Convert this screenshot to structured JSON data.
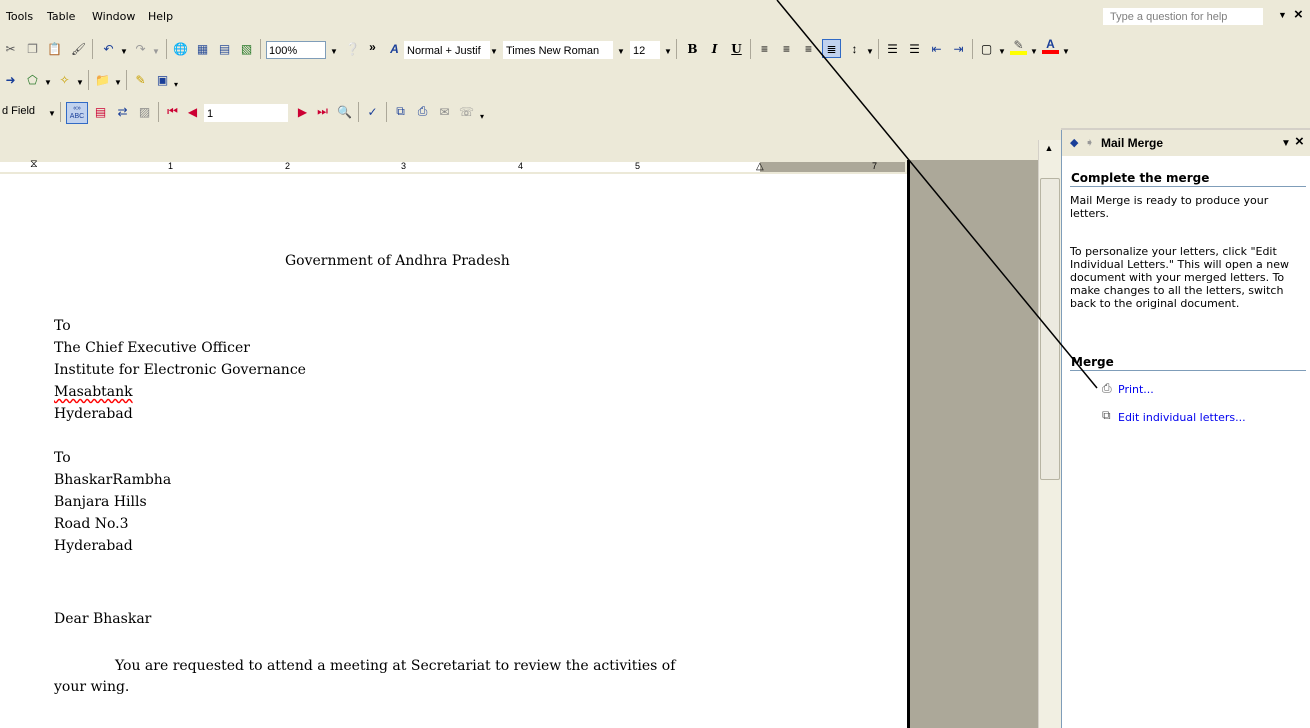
{
  "menubar": {
    "items": [
      "Tools",
      "Table",
      "Window",
      "Help"
    ],
    "help_placeholder": "Type a question for help",
    "close_glyph": "×"
  },
  "toolbar_standard": {
    "zoom": "100%",
    "style": "Normal + Justif",
    "font": "Times New Roman",
    "font_size": "12",
    "bold": "B",
    "italic": "I",
    "underline": "U",
    "more": "»"
  },
  "toolbar_mailmerge": {
    "insert_field_label": "d Field",
    "record_number": "1",
    "abc_label": "«» ABC"
  },
  "ruler": {
    "numbers": [
      "1",
      "2",
      "3",
      "4",
      "5",
      "7"
    ]
  },
  "document": {
    "heading": "Government of Andhra Pradesh",
    "to1": "To",
    "addr1_line1": "The Chief Executive Officer",
    "addr1_line2": "Institute for Electronic Governance",
    "addr1_line3": "Masabtank",
    "addr1_line4": "Hyderabad",
    "to2": "To",
    "addr2_line1": "BhaskarRambha",
    "addr2_line2": "Banjara Hills",
    "addr2_line3": "Road No.3",
    "addr2_line4": "Hyderabad",
    "salutation": "Dear Bhaskar",
    "body_line1": "You are requested to attend a meeting at Secretariat to review the activities of",
    "body_line2": "your wing."
  },
  "taskpane": {
    "title": "Mail Merge",
    "section_complete": "Complete the merge",
    "ready_text": "Mail Merge is ready to produce your letters.",
    "personalize_text": "To personalize your letters, click \"Edit Individual Letters.\" This will open a new document with your merged letters. To make changes to all the letters, switch back to the original document.",
    "section_merge": "Merge",
    "print_link": "Print...",
    "edit_link": "Edit individual letters..."
  },
  "colors": {
    "link": "#0000ee",
    "pane_border": "#7f9db9",
    "toolbar_bg": "#ece9d8",
    "page_grey": "#aca899",
    "spell_error": "#ff0000"
  }
}
